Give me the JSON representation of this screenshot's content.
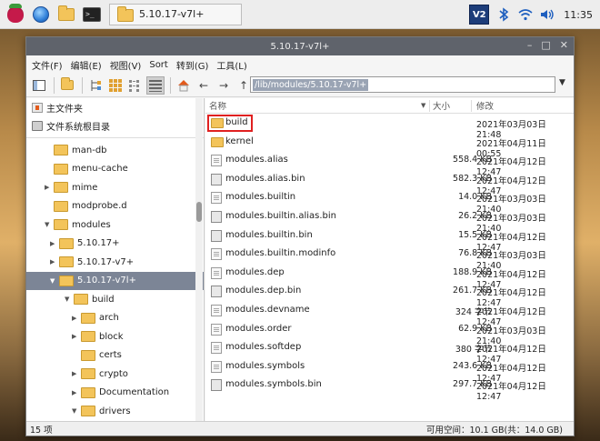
{
  "taskbar": {
    "task_label": "5.10.17-v7l+",
    "vnc_label": "V2",
    "clock": "11:35"
  },
  "window": {
    "title": "5.10.17-v7l+"
  },
  "menu": [
    {
      "label": "文件(F)"
    },
    {
      "label": "编辑(E)"
    },
    {
      "label": "视图(V)"
    },
    {
      "label": "Sort"
    },
    {
      "label": "转到(G)"
    },
    {
      "label": "工具(L)"
    }
  ],
  "path": {
    "value": "/lib/modules/5.10.17-v7l+"
  },
  "places": [
    {
      "label": "主文件夹",
      "icon": "home-icon"
    },
    {
      "label": "文件系统根目录",
      "icon": "drive-icon"
    }
  ],
  "tree": [
    {
      "label": "man-db",
      "level": 1,
      "arrow": "",
      "selected": false
    },
    {
      "label": "menu-cache",
      "level": 1,
      "arrow": "",
      "selected": false
    },
    {
      "label": "mime",
      "level": 1,
      "arrow": "▶",
      "selected": false
    },
    {
      "label": "modprobe.d",
      "level": 1,
      "arrow": "",
      "selected": false
    },
    {
      "label": "modules",
      "level": 1,
      "arrow": "▼",
      "selected": false
    },
    {
      "label": "5.10.17+",
      "level": 2,
      "arrow": "▶",
      "selected": false
    },
    {
      "label": "5.10.17-v7+",
      "level": 2,
      "arrow": "▶",
      "selected": false
    },
    {
      "label": "5.10.17-v7l+",
      "level": 2,
      "arrow": "▼",
      "selected": true
    },
    {
      "label": "build",
      "level": 3,
      "arrow": "▼",
      "selected": false
    },
    {
      "label": "arch",
      "level": 4,
      "arrow": "▶",
      "selected": false
    },
    {
      "label": "block",
      "level": 4,
      "arrow": "▶",
      "selected": false
    },
    {
      "label": "certs",
      "level": 4,
      "arrow": "",
      "selected": false
    },
    {
      "label": "crypto",
      "level": 4,
      "arrow": "▶",
      "selected": false
    },
    {
      "label": "Documentation",
      "level": 4,
      "arrow": "▶",
      "selected": false
    },
    {
      "label": "drivers",
      "level": 4,
      "arrow": "▼",
      "selected": false
    }
  ],
  "columns": {
    "name": "名称",
    "size": "大小",
    "modified": "修改"
  },
  "files": [
    {
      "name": "build",
      "size": "",
      "date": "2021年03月03日 21:48",
      "type": "folder-link",
      "highlight": true
    },
    {
      "name": "kernel",
      "size": "",
      "date": "2021年04月11日 00:55",
      "type": "folder",
      "highlight": false
    },
    {
      "name": "modules.alias",
      "size": "558.4 KB",
      "date": "2021年04月12日 12:47",
      "type": "file",
      "highlight": false
    },
    {
      "name": "modules.alias.bin",
      "size": "582.3 KB",
      "date": "2021年04月12日 12:47",
      "type": "sym",
      "highlight": false
    },
    {
      "name": "modules.builtin",
      "size": "14.0 KB",
      "date": "2021年03月03日 21:40",
      "type": "file",
      "highlight": false
    },
    {
      "name": "modules.builtin.alias.bin",
      "size": "26.2 KB",
      "date": "2021年03月03日 21:40",
      "type": "sym",
      "highlight": false
    },
    {
      "name": "modules.builtin.bin",
      "size": "15.5 KB",
      "date": "2021年04月12日 12:47",
      "type": "sym",
      "highlight": false
    },
    {
      "name": "modules.builtin.modinfo",
      "size": "76.8 KB",
      "date": "2021年03月03日 21:40",
      "type": "file",
      "highlight": false
    },
    {
      "name": "modules.dep",
      "size": "188.9 KB",
      "date": "2021年04月12日 12:47",
      "type": "file",
      "highlight": false
    },
    {
      "name": "modules.dep.bin",
      "size": "261.7 KB",
      "date": "2021年04月12日 12:47",
      "type": "sym",
      "highlight": false
    },
    {
      "name": "modules.devname",
      "size": "324 字节",
      "date": "2021年04月12日 12:47",
      "type": "file",
      "highlight": false
    },
    {
      "name": "modules.order",
      "size": "62.9 KB",
      "date": "2021年03月03日 21:40",
      "type": "file",
      "highlight": false
    },
    {
      "name": "modules.softdep",
      "size": "380 字节",
      "date": "2021年04月12日 12:47",
      "type": "file",
      "highlight": false
    },
    {
      "name": "modules.symbols",
      "size": "243.6 KB",
      "date": "2021年04月12日 12:47",
      "type": "file",
      "highlight": false
    },
    {
      "name": "modules.symbols.bin",
      "size": "297.7 KB",
      "date": "2021年04月12日 12:47",
      "type": "sym",
      "highlight": false
    }
  ],
  "status": {
    "count": "15 项",
    "free": "可用空间：10.1 GB(共：14.0 GB)"
  }
}
